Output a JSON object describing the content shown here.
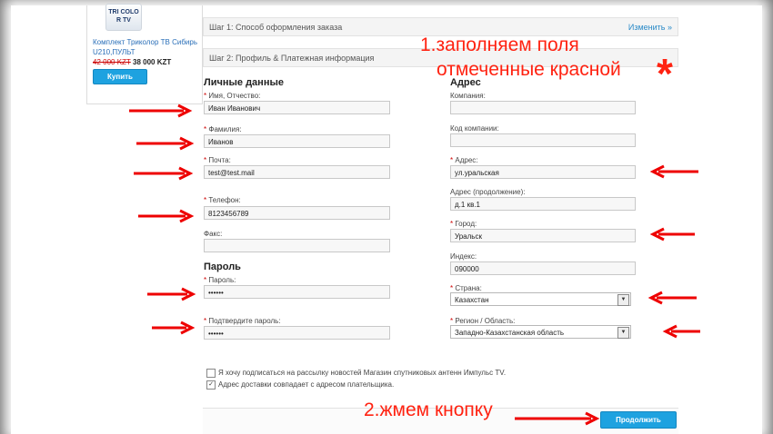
{
  "sidebar": {
    "product_image_text": "TRI COLO R TV",
    "product_name": "Комплект Триколор ТВ Сибирь U210,ПУЛЬТ",
    "old_price": "42 000 KZT",
    "new_price": "38 000 KZT",
    "buy_label": "Купить"
  },
  "steps": {
    "step1": "Шаг 1: Способ оформления заказа",
    "step1_link": "Изменить »",
    "step2": "Шаг 2: Профиль & Платежная информация"
  },
  "personal": {
    "heading": "Личные данные",
    "name_label": "Имя, Отчество:",
    "name_value": "Иван  Иванович",
    "surname_label": "Фамилия:",
    "surname_value": "Иванов",
    "email_label": "Почта:",
    "email_value": "test@test.mail",
    "phone_label": "Телефон:",
    "phone_value": "8123456789",
    "fax_label": "Факс:",
    "fax_value": ""
  },
  "password": {
    "heading": "Пароль",
    "pass_label": "Пароль:",
    "pass_value": "••••••",
    "confirm_label": "Подтвердите пароль:",
    "confirm_value": "••••••"
  },
  "address": {
    "heading": "Адрес",
    "company_label": "Компания:",
    "company_value": "",
    "company_code_label": "Код компании:",
    "company_code_value": "",
    "address_label": "Адрес:",
    "address_value": "ул.уральская",
    "address2_label": "Адрес (продолжение):",
    "address2_value": "д.1 кв.1",
    "city_label": "Город:",
    "city_value": "Уральск",
    "zip_label": "Индекс:",
    "zip_value": "090000",
    "country_label": "Страна:",
    "country_value": "Казахстан",
    "region_label": "Регион / Область:",
    "region_value": "Западно-Казахстанская область"
  },
  "options": {
    "newsletter_label": "Я хочу подписаться на рассылку новостей Магазин спутниковых антенн Импульс TV.",
    "newsletter_checked": false,
    "same_address_label": "Адрес доставки совпадает с адресом плательщика.",
    "same_address_checked": true
  },
  "continue_label": "Продолжить",
  "annotations": {
    "line1": "1.заполняем поля",
    "line2": "отмеченные красной",
    "star": "*",
    "line3": "2.жмем кнопку"
  },
  "required_mark": "*",
  "colors": {
    "annotation": "#f21",
    "button": "#1ea2e0",
    "link": "#2a6fb8"
  }
}
